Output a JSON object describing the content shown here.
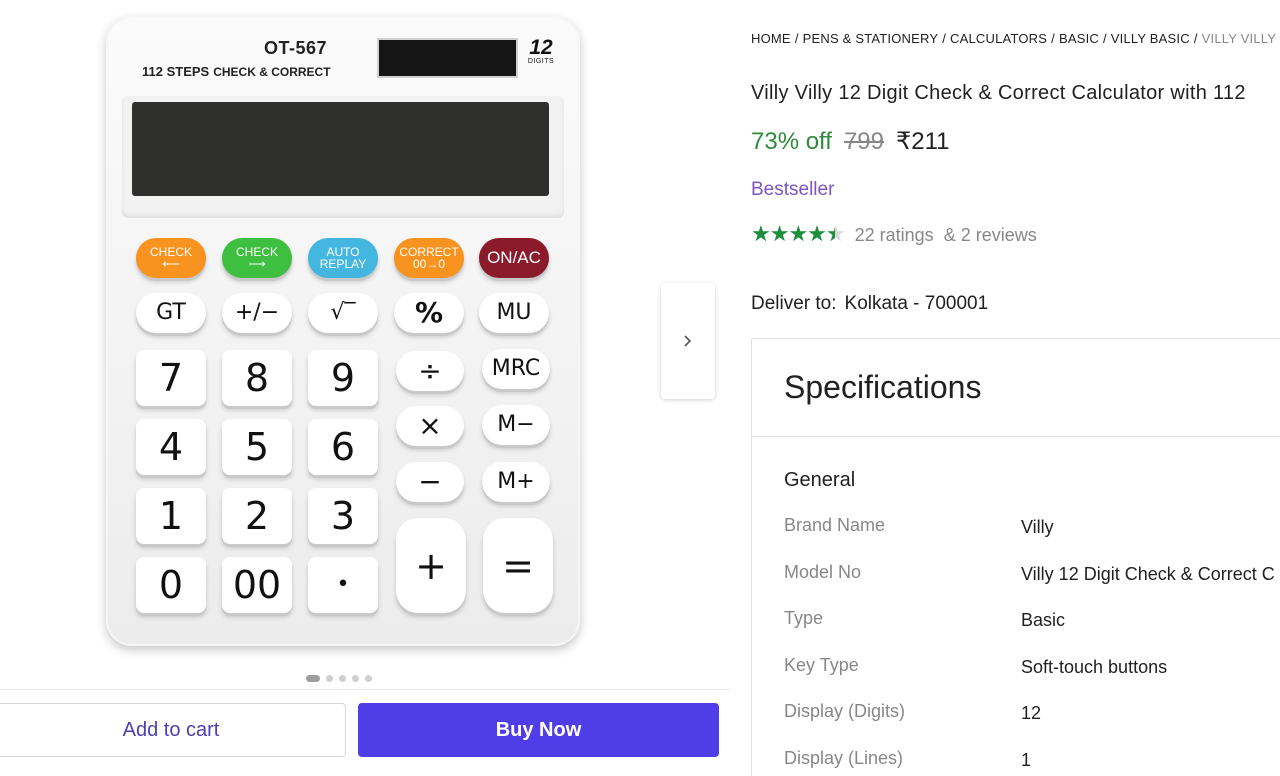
{
  "product_image": {
    "model": "OT-567",
    "steps_label": "112 STEPS",
    "check_label": "CHECK & CORRECT",
    "digits_big": "12",
    "digits_small": "DIGITS",
    "keys": {
      "check_left": [
        "CHECK",
        "⟵"
      ],
      "check_right": [
        "CHECK",
        "⟶"
      ],
      "auto_replay": [
        "AUTO",
        "REPLAY"
      ],
      "correct": [
        "CORRECT",
        "00→0"
      ],
      "on_ac": "ON/AC",
      "gt": "GT",
      "plus_minus": "+/−",
      "sqrt": "√‾",
      "percent": "%",
      "mu": "MU",
      "k7": "7",
      "k8": "8",
      "k9": "9",
      "divide": "÷",
      "mrc": "MRC",
      "k4": "4",
      "k5": "5",
      "k6": "6",
      "multiply": "×",
      "m_minus": "M−",
      "k1": "1",
      "k2": "2",
      "k3": "3",
      "minus": "−",
      "m_plus": "M+",
      "k0": "0",
      "k00": "00",
      "dot": "•",
      "plus": "+",
      "equals": "="
    }
  },
  "carousel": {
    "next_icon": "chevron-right-icon",
    "total": 5,
    "active": 1
  },
  "actions": {
    "add_to_cart": "Add to cart",
    "buy_now": "Buy Now"
  },
  "breadcrumb": [
    "HOME",
    "PENS & STATIONERY",
    "CALCULATORS",
    "BASIC",
    "VILLY BASIC",
    "VILLY VILLY"
  ],
  "product": {
    "title": "Villy Villy 12 Digit Check & Correct Calculator with 112",
    "discount": "73% off",
    "mrp": "799",
    "price": "₹211",
    "badge": "Bestseller",
    "rating_value": 4.5,
    "ratings": "22 ratings",
    "reviews": "& 2 reviews"
  },
  "delivery": {
    "label": "Deliver to:",
    "location": "Kolkata - 700001"
  },
  "specs": {
    "heading": "Specifications",
    "section": "General",
    "rows": [
      {
        "key": "Brand Name",
        "value": "Villy"
      },
      {
        "key": "Model No",
        "value": "Villy 12 Digit Check & Correct C"
      },
      {
        "key": "Type",
        "value": "Basic"
      },
      {
        "key": "Key Type",
        "value": "Soft-touch buttons"
      },
      {
        "key": "Display (Digits)",
        "value": "12"
      },
      {
        "key": "Display (Lines)",
        "value": "1"
      }
    ]
  },
  "colors": {
    "accent": "#4f3ee8",
    "discount_green": "#2e8b3a",
    "badge_purple": "#7d53c6",
    "star_green": "#1e8e3e"
  }
}
